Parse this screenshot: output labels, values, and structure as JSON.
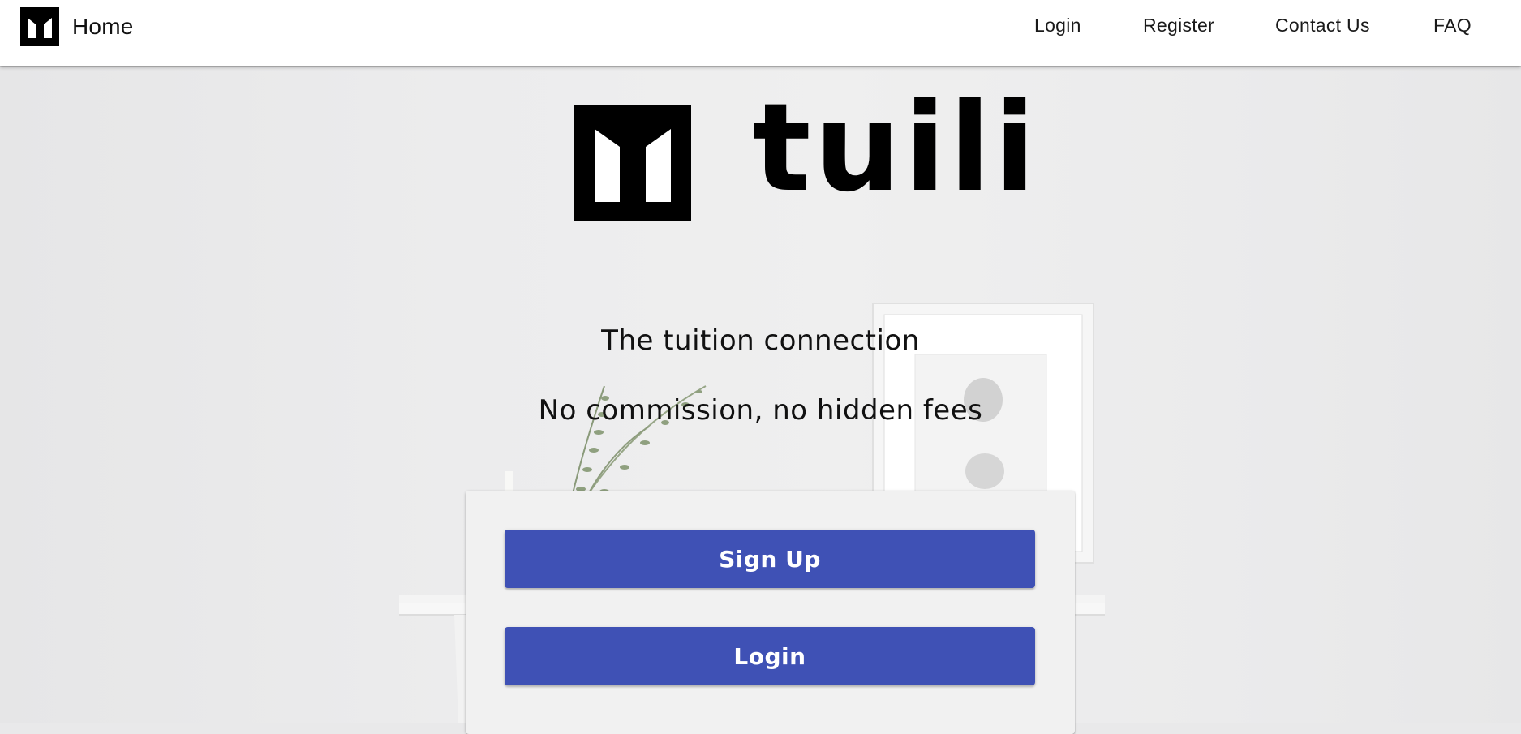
{
  "header": {
    "brand_icon": "tuili-logo-icon",
    "brand_label": "Home",
    "nav": [
      {
        "label": "Login"
      },
      {
        "label": "Register"
      },
      {
        "label": "Contact Us"
      },
      {
        "label": "FAQ"
      }
    ]
  },
  "hero": {
    "logo_icon": "tuili-logo-icon",
    "wordmark": "tuili",
    "tagline": "The tuition connection",
    "subtagline": "No commission, no hidden fees"
  },
  "card": {
    "signup_label": "Sign Up",
    "login_label": "Login"
  },
  "colors": {
    "primary": "#3f51b5",
    "appbar": "#ffffff",
    "background": "#ececed",
    "card": "#f1f1f1"
  }
}
